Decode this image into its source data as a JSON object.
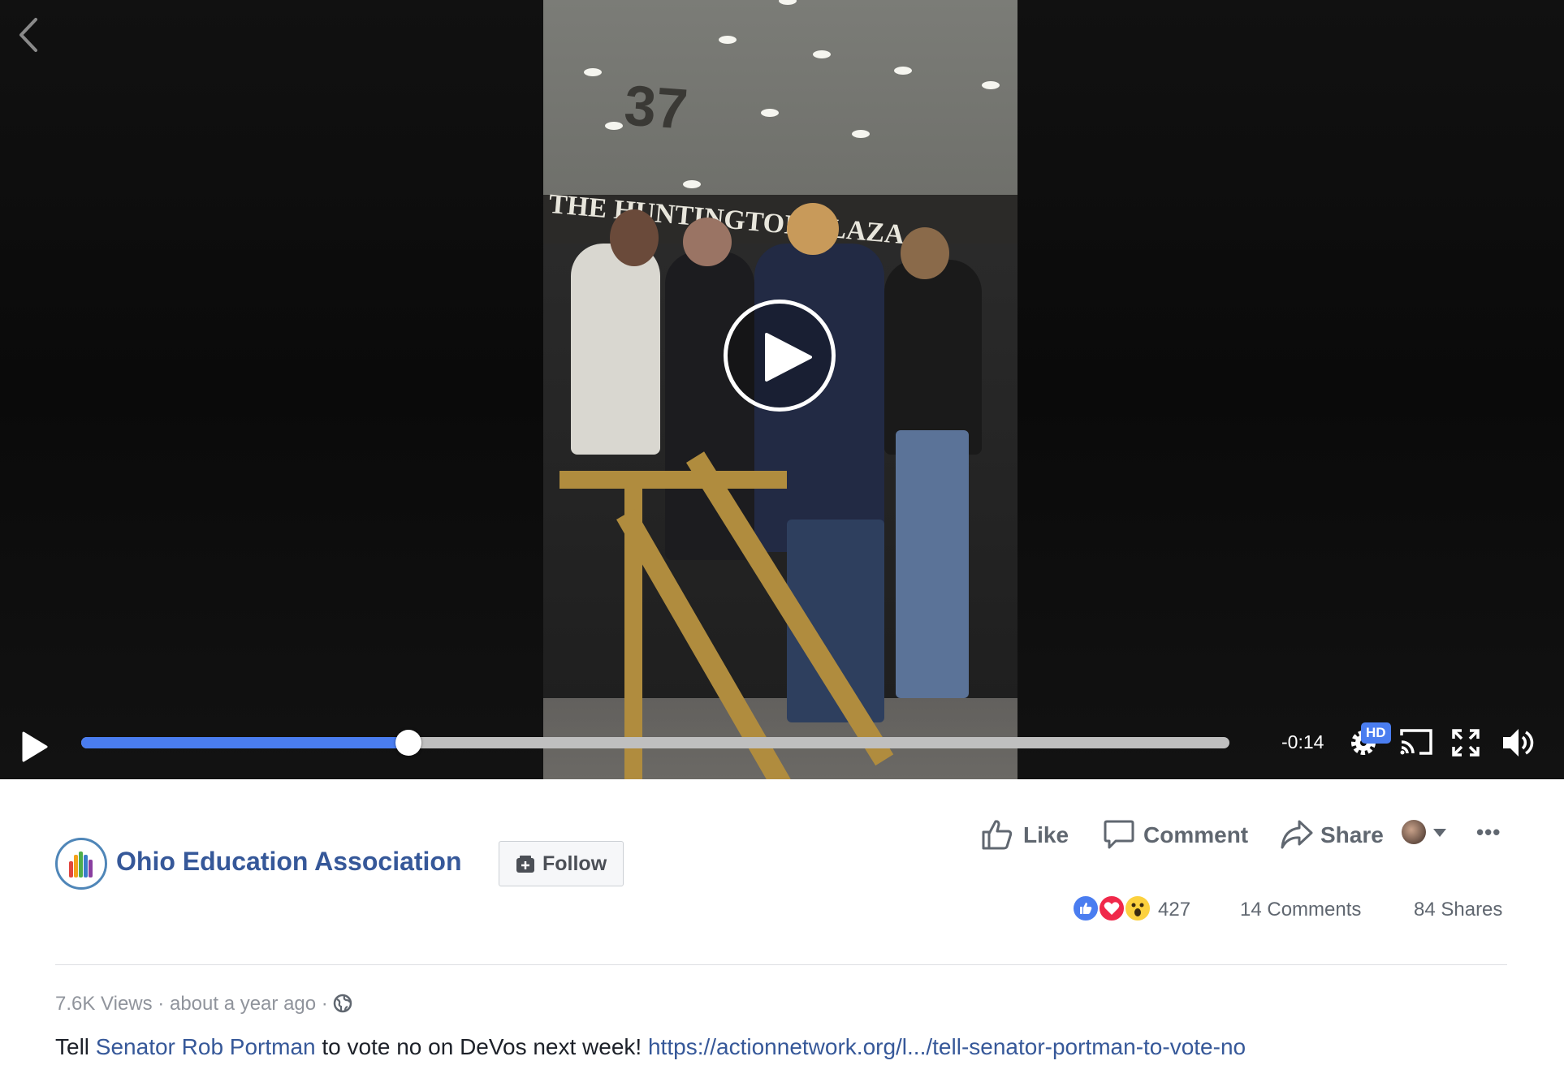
{
  "video": {
    "building_number": "37",
    "sign_text": "THE HUNTINGTON PLAZA",
    "time_remaining": "-0:14",
    "progress": 0.285,
    "quality_badge": "HD",
    "accent_color": "#4a7df0"
  },
  "icons": {
    "back": "chevron-left-icon",
    "big_play": "play-circle-icon",
    "play": "play-icon",
    "settings": "gear-icon",
    "cast": "cast-icon",
    "fullscreen": "fullscreen-icon",
    "volume": "volume-icon"
  },
  "page": {
    "name": "Ohio Education Association",
    "follow_label": "Follow"
  },
  "actions": {
    "like": "Like",
    "comment": "Comment",
    "share": "Share",
    "more": "•••"
  },
  "stats": {
    "reactions_count": "427",
    "comments": "14 Comments",
    "shares": "84 Shares",
    "reaction_icons": [
      "like-reaction-icon",
      "love-reaction-icon",
      "wow-reaction-icon"
    ]
  },
  "meta": {
    "views": "7.6K Views",
    "separator": "·",
    "time": "about a year ago",
    "privacy_icon": "globe-icon"
  },
  "description": {
    "prefix": "Tell ",
    "mention": "Senator Rob Portman",
    "middle": " to vote no on DeVos next week! ",
    "link": "https://actionnetwork.org/l.../tell-senator-portman-to-vote-no"
  }
}
